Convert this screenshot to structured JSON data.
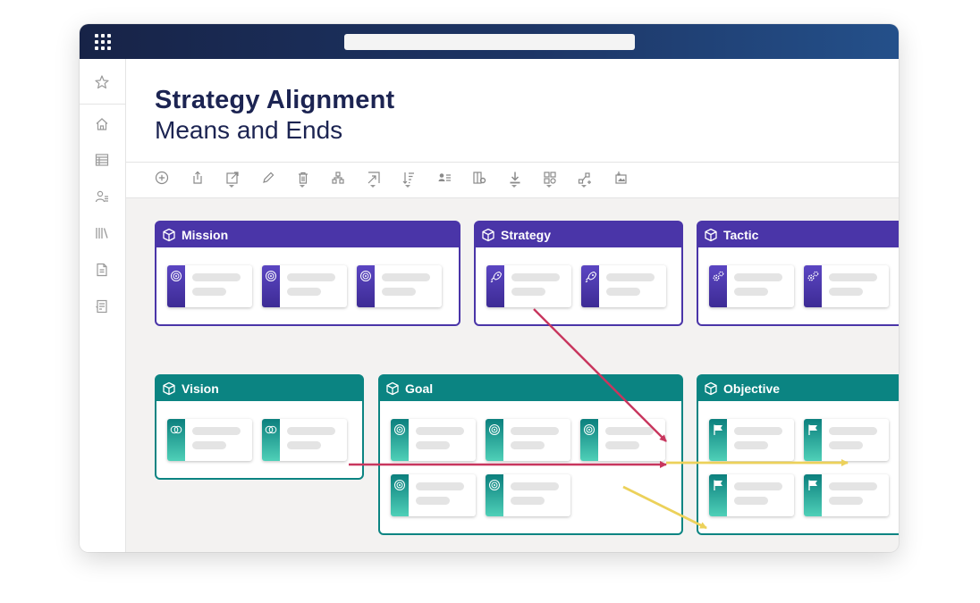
{
  "header": {
    "title": "Strategy Alignment",
    "subtitle": "Means and Ends"
  },
  "sidebar": {
    "items": [
      {
        "icon": "star-icon"
      },
      {
        "icon": "home-icon"
      },
      {
        "icon": "table-icon"
      },
      {
        "icon": "users-icon"
      },
      {
        "icon": "library-icon"
      },
      {
        "icon": "document-icon"
      },
      {
        "icon": "checklist-icon"
      }
    ]
  },
  "toolbar": {
    "tools": [
      {
        "icon": "add-icon"
      },
      {
        "icon": "share-icon"
      },
      {
        "icon": "open-external-icon"
      },
      {
        "icon": "pencil-icon"
      },
      {
        "icon": "trash-icon"
      },
      {
        "icon": "hierarchy-icon"
      },
      {
        "icon": "expand-icon"
      },
      {
        "icon": "sort-icon"
      },
      {
        "icon": "people-list-icon"
      },
      {
        "icon": "column-settings-icon"
      },
      {
        "icon": "download-icon"
      },
      {
        "icon": "layout-icon"
      },
      {
        "icon": "connect-icon"
      },
      {
        "icon": "image-export-icon"
      }
    ]
  },
  "groups": {
    "mission": {
      "label": "Mission",
      "cards": 3,
      "card_icon": "target-icon"
    },
    "strategy": {
      "label": "Strategy",
      "cards": 2,
      "card_icon": "rocket-icon"
    },
    "tactic": {
      "label": "Tactic",
      "cards": 2,
      "card_icon": "gears-icon"
    },
    "vision": {
      "label": "Vision",
      "cards": 2,
      "card_icon": "overlap-circles-icon"
    },
    "goal": {
      "label": "Goal",
      "cards": 5,
      "card_icon": "target-icon"
    },
    "objective": {
      "label": "Objective",
      "cards": 4,
      "card_icon": "flag-icon"
    }
  },
  "colors": {
    "purple": "#4a35a8",
    "teal": "#0b8482",
    "arrow_red": "#c8365e",
    "arrow_yellow": "#ecd15a",
    "titlebar": "#172347"
  },
  "links": [
    {
      "from": "Strategy",
      "to": "Goal",
      "color": "#c8365e"
    },
    {
      "from": "Vision",
      "to": "Goal",
      "color": "#c8365e"
    },
    {
      "from": "Goal",
      "to": "Objective",
      "color": "#ecd15a"
    },
    {
      "from": "Goal",
      "to": "Objective",
      "color": "#ecd15a"
    }
  ]
}
